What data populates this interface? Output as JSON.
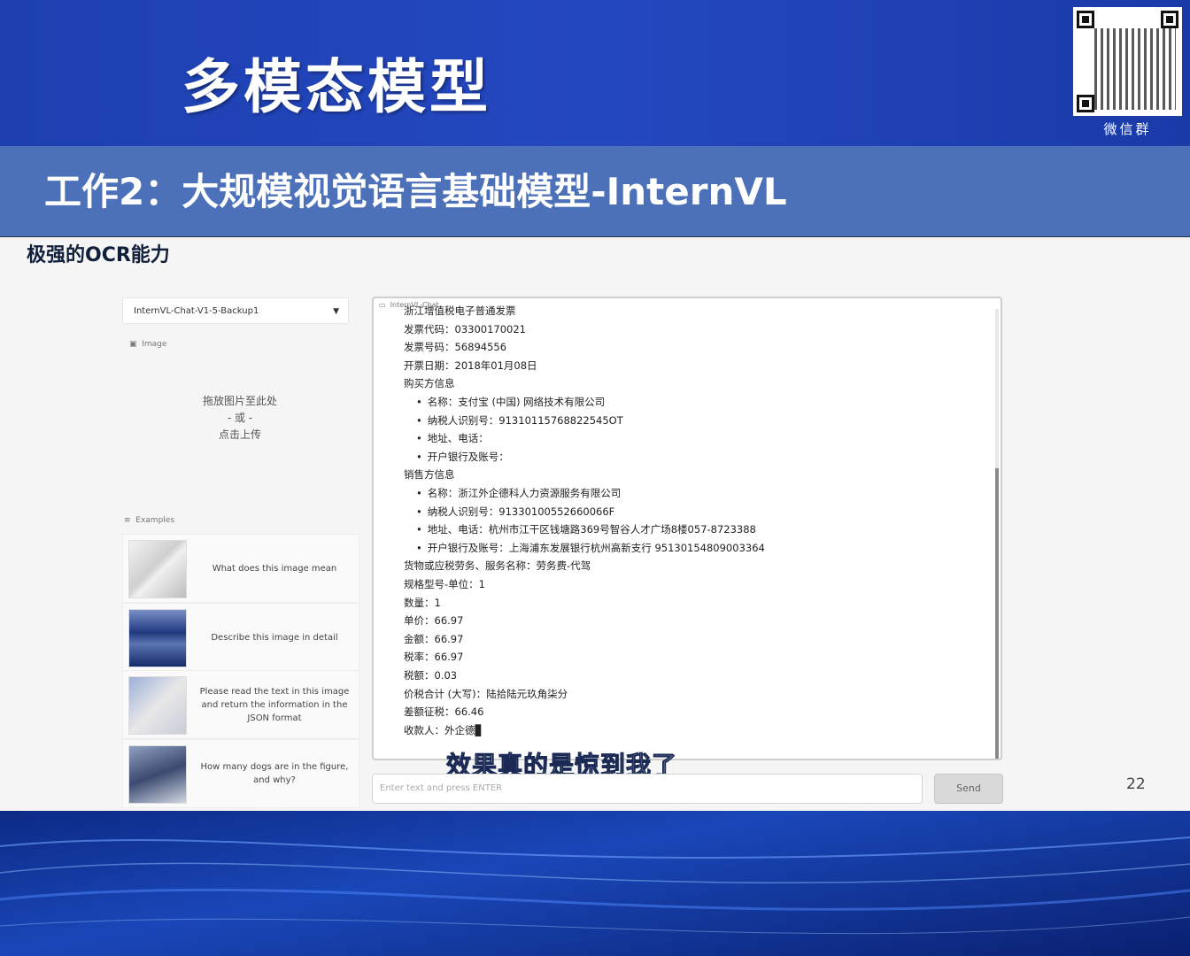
{
  "slide": {
    "title": "多模态模型",
    "subtitle": "工作2：大规模视觉语言基础模型-InternVL",
    "feature_label": "极强的OCR能力",
    "page_number": "22",
    "qr_label": "微信群",
    "caption": "效果真的是惊到我了"
  },
  "demo": {
    "model_select": "InternVL-Chat-V1-5-Backup1",
    "image_label": "Image",
    "upload": {
      "line1": "拖放图片至此处",
      "line2": "- 或 -",
      "line3": "点击上传"
    },
    "examples_label": "Examples",
    "examples": [
      {
        "text": "What does this image mean"
      },
      {
        "text": "Describe this image in detail"
      },
      {
        "text": "Please read the text in this image and return the information in the JSON format"
      },
      {
        "text": "How many dogs are in the figure, and why?"
      }
    ],
    "chat_header": "InternVL-Chat",
    "ocr_lines": [
      {
        "text": "浙江增值税电子普通发票",
        "indent": false
      },
      {
        "text": "发票代码：03300170021",
        "indent": false
      },
      {
        "text": "发票号码：56894556",
        "indent": false
      },
      {
        "text": "开票日期：2018年01月08日",
        "indent": false
      },
      {
        "text": "购买方信息",
        "indent": false
      },
      {
        "text": "名称：支付宝 (中国) 网络技术有限公司",
        "indent": true
      },
      {
        "text": "纳税人识别号：91310115768822545OT",
        "indent": true
      },
      {
        "text": "地址、电话：",
        "indent": true
      },
      {
        "text": "开户银行及账号：",
        "indent": true
      },
      {
        "text": "销售方信息",
        "indent": false
      },
      {
        "text": "名称：浙江外企德科人力资源服务有限公司",
        "indent": true
      },
      {
        "text": "纳税人识别号：91330100552660066F",
        "indent": true
      },
      {
        "text": "地址、电话：杭州市江干区钱塘路369号智谷人才广场8楼057-8723388",
        "indent": true
      },
      {
        "text": "开户银行及账号：上海浦东发展银行杭州高新支行 95130154809003364",
        "indent": true
      },
      {
        "text": "货物或应税劳务、服务名称：劳务费-代驾",
        "indent": false
      },
      {
        "text": "规格型号-单位：1",
        "indent": false
      },
      {
        "text": "数量：1",
        "indent": false
      },
      {
        "text": "单价：66.97",
        "indent": false
      },
      {
        "text": "金额：66.97",
        "indent": false
      },
      {
        "text": "税率：66.97",
        "indent": false
      },
      {
        "text": "税额：0.03",
        "indent": false
      },
      {
        "text": "价税合计 (大写)：陆拾陆元玖角柒分",
        "indent": false
      },
      {
        "text": "差额征税：66.46",
        "indent": false
      },
      {
        "text": "收款人：外企德▊",
        "indent": false
      }
    ],
    "input_placeholder": "Enter text and press ENTER",
    "send_label": "Send"
  }
}
